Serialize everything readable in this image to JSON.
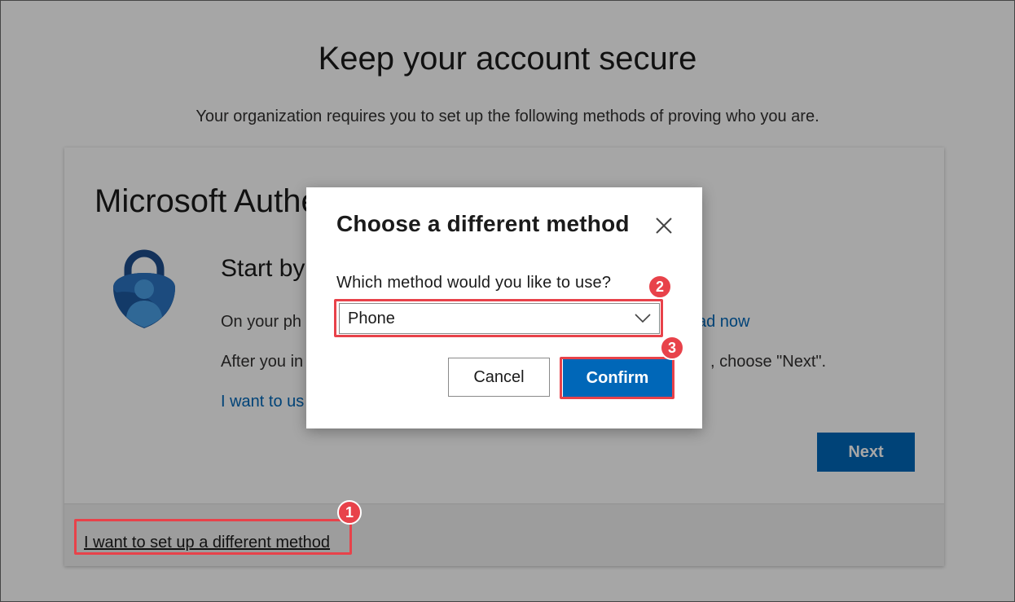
{
  "page": {
    "title": "Keep your account secure",
    "subtitle": "Your organization requires you to set up the following methods of proving who you are."
  },
  "card": {
    "title": "Microsoft Authe",
    "start_heading": "Start by",
    "line1": "On your ph",
    "download_link": "ad now",
    "line2": "After you in",
    "line2_suffix": ", choose \"Next\".",
    "line3_link": "I want to us",
    "next_label": "Next",
    "footer_link": "I want to set up a different method"
  },
  "dialog": {
    "title": "Choose a different method",
    "label": "Which method would you like to use?",
    "select_value": "Phone",
    "cancel_label": "Cancel",
    "confirm_label": "Confirm"
  },
  "annotations": [
    "1",
    "2",
    "3"
  ],
  "colors": {
    "accent": "#0067b8",
    "annotation": "#e8424a",
    "logo_dark": "#1e4e8c",
    "logo_light": "#3d8fd6"
  }
}
